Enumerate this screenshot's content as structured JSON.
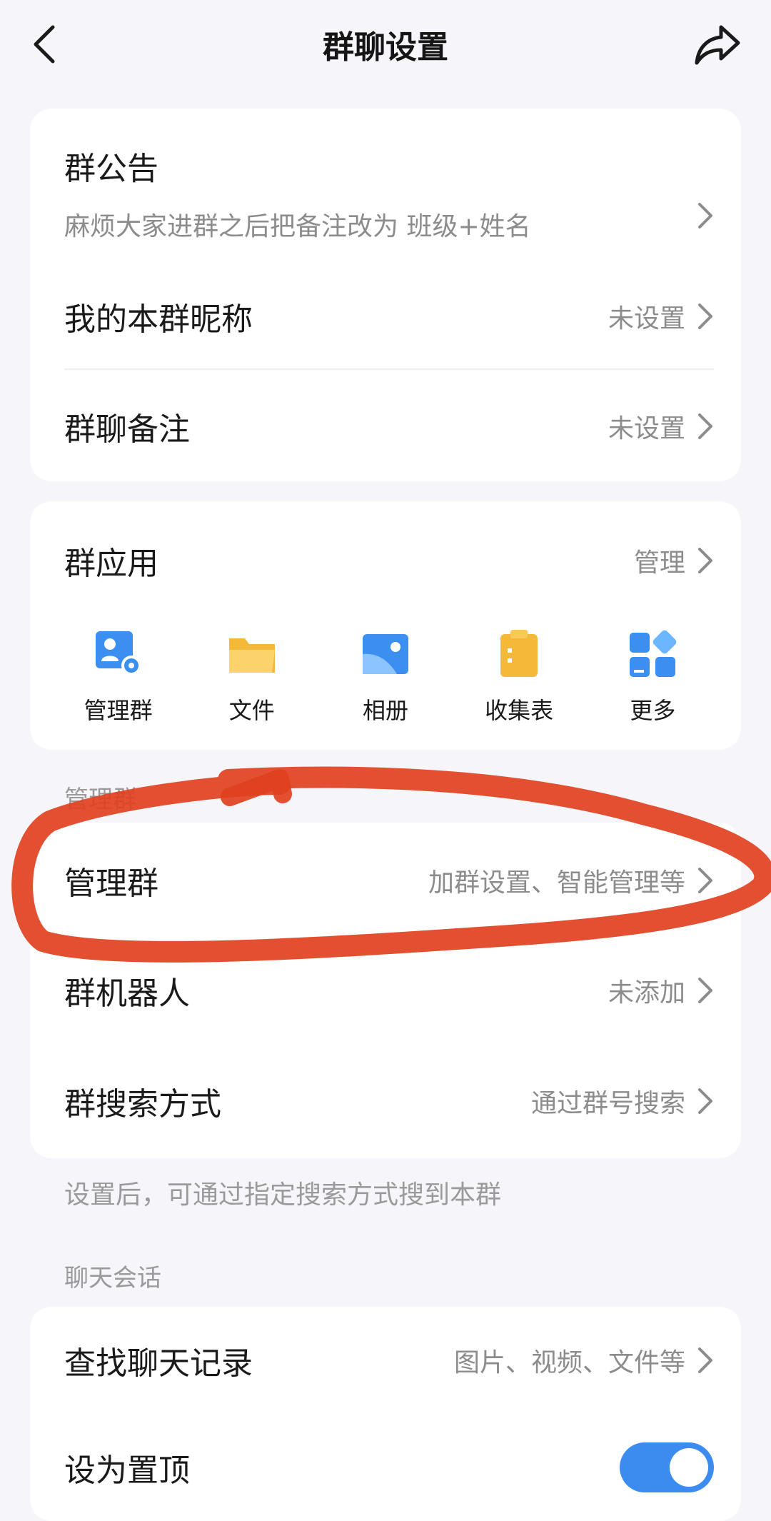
{
  "header": {
    "title": "群聊设置"
  },
  "info_card": {
    "announcement_label": "群公告",
    "announcement_text": "麻烦大家进群之后把备注改为 班级+姓名",
    "nickname_label": "我的本群昵称",
    "nickname_value": "未设置",
    "remark_label": "群聊备注",
    "remark_value": "未设置"
  },
  "apps_card": {
    "label": "群应用",
    "manage_label": "管理",
    "items": [
      {
        "label": "管理群",
        "icon": "manage-group-icon"
      },
      {
        "label": "文件",
        "icon": "folder-icon"
      },
      {
        "label": "相册",
        "icon": "photo-album-icon"
      },
      {
        "label": "收集表",
        "icon": "clipboard-icon"
      },
      {
        "label": "更多",
        "icon": "more-apps-icon"
      }
    ]
  },
  "manage_section": {
    "section_label": "管理群",
    "manage_label": "管理群",
    "manage_value": "加群设置、智能管理等",
    "robot_label": "群机器人",
    "robot_value": "未添加",
    "search_label": "群搜索方式",
    "search_value": "通过群号搜索",
    "footnote": "设置后，可通过指定搜索方式搜到本群"
  },
  "chat_section": {
    "section_label": "聊天会话",
    "history_label": "查找聊天记录",
    "history_value": "图片、视频、文件等",
    "pin_label": "设为置顶",
    "pin_on": true
  },
  "colors": {
    "background": "#f6f6fa",
    "card": "#ffffff",
    "toggle_on": "#3c8cf0",
    "annotation": "#e0411f",
    "app_blue": "#3b8ff0",
    "app_yellow": "#f5b93a"
  }
}
